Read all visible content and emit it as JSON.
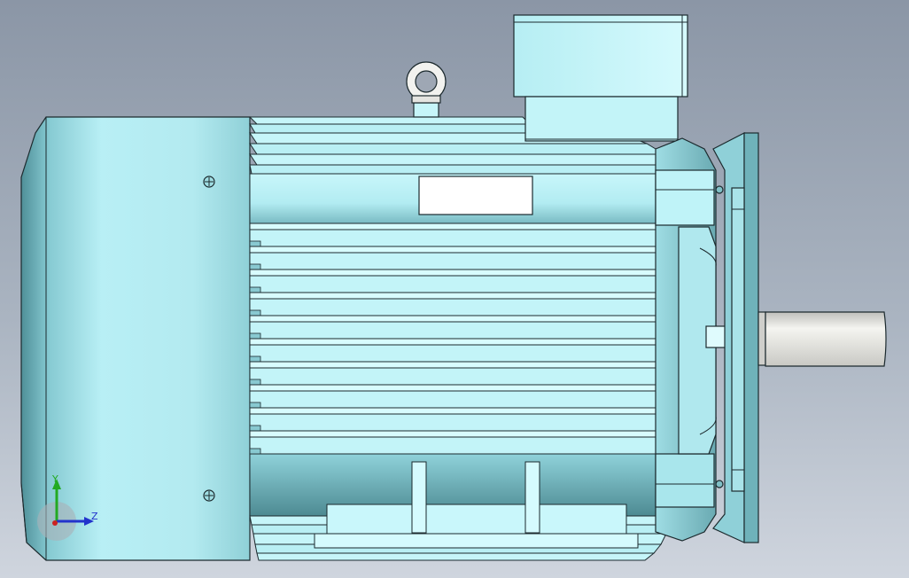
{
  "viewport": {
    "background_top": "#8b96a6",
    "background_bottom": "#cfd5de"
  },
  "model": {
    "body_color": "#bdf3f8",
    "body_shade": "#5aa6ae",
    "fin_color": "#ccf8fb",
    "shaft_color": "#e6e6e2",
    "fins_count": 10
  },
  "triad": {
    "y_label": "Y",
    "z_label": "Z",
    "y_color": "#22aa22",
    "z_color": "#2233cc",
    "x_color": "#cc2222"
  }
}
